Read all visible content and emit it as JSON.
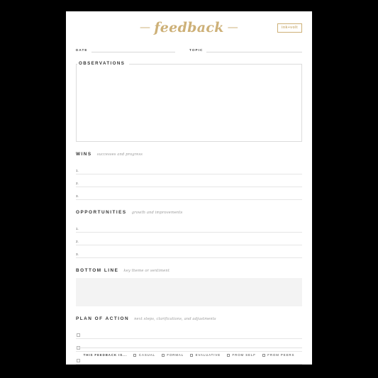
{
  "theme": {
    "gold": "#cdb077",
    "ink": "#333333",
    "muted": "#9a9a9a",
    "rule": "#e6e6e6",
    "gray_fill": "#f3f3f3",
    "page_bg": "#ffffff",
    "canvas_bg": "#000000"
  },
  "header": {
    "dash_left": "—",
    "title": "feedback",
    "dash_right": "—",
    "logo": "ink+volt"
  },
  "meta": {
    "date_label": "DATE",
    "topic_label": "TOPIC",
    "date_value": "",
    "topic_value": ""
  },
  "observations": {
    "label": "OBSERVATIONS",
    "value": ""
  },
  "wins": {
    "title": "WINS",
    "subtitle": "successes and progress",
    "items": [
      {
        "num": "1.",
        "value": ""
      },
      {
        "num": "2.",
        "value": ""
      },
      {
        "num": "3.",
        "value": ""
      }
    ]
  },
  "opportunities": {
    "title": "OPPORTUNITIES",
    "subtitle": "growth and improvements",
    "items": [
      {
        "num": "1.",
        "value": ""
      },
      {
        "num": "2.",
        "value": ""
      },
      {
        "num": "3.",
        "value": ""
      }
    ]
  },
  "bottom_line": {
    "title": "BOTTOM LINE",
    "subtitle": "key theme or sentiment",
    "value": ""
  },
  "plan_of_action": {
    "title": "PLAN OF ACTION",
    "subtitle": "next steps, clarifications, and adjustments",
    "items": [
      {
        "checked": false,
        "value": ""
      },
      {
        "checked": false,
        "value": ""
      },
      {
        "checked": false,
        "value": ""
      }
    ]
  },
  "footer": {
    "lead": "THIS FEEDBACK IS...",
    "options": [
      {
        "label": "CASUAL",
        "checked": false
      },
      {
        "label": "FORMAL",
        "checked": false
      },
      {
        "label": "EVALUATIVE",
        "checked": false
      },
      {
        "label": "FROM SELF",
        "checked": false
      },
      {
        "label": "FROM PEERS",
        "checked": false
      }
    ]
  }
}
